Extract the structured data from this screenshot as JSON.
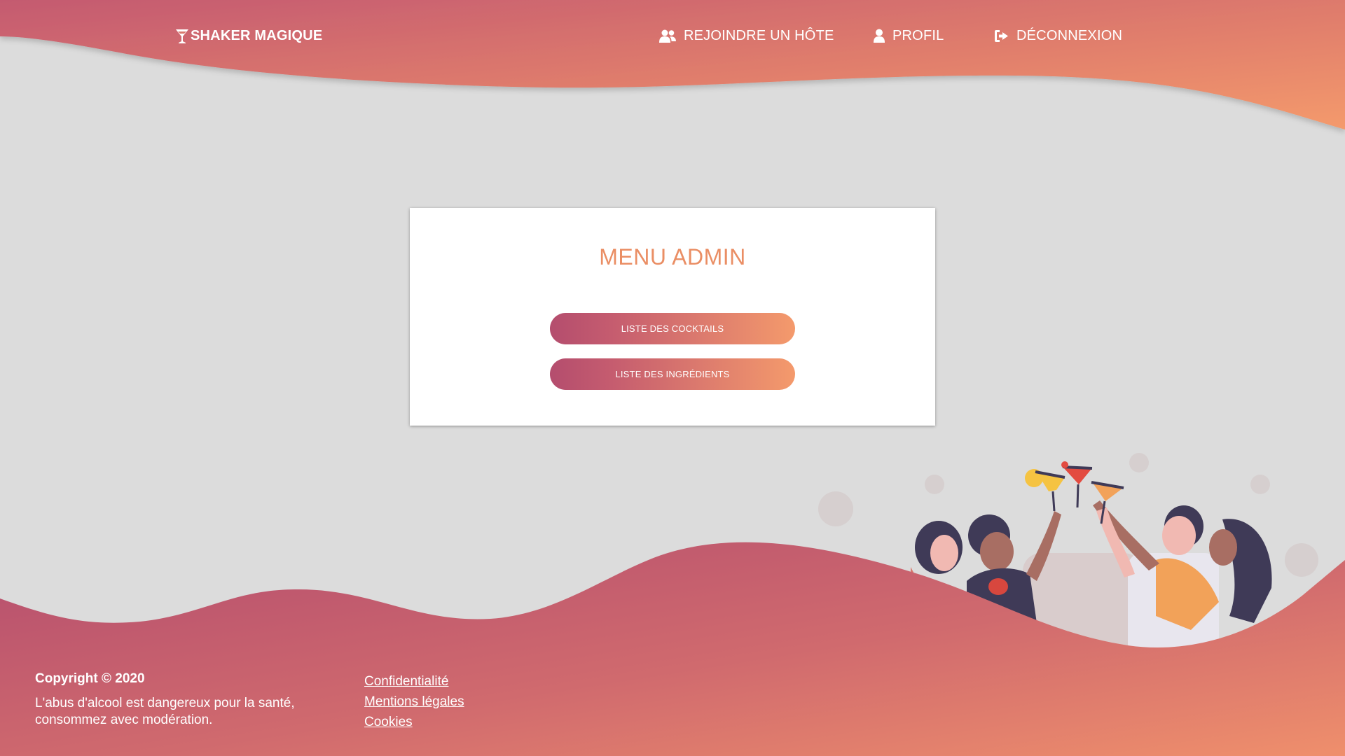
{
  "nav": {
    "brand": "SHAKER MAGIQUE",
    "join_host": "REJOINDRE UN HÔTE",
    "profile": "PROFIL",
    "logout": "DÉCONNEXION"
  },
  "card": {
    "title": "MENU ADMIN",
    "buttons": [
      "LISTE DES COCKTAILS",
      "LISTE DES INGRÉDIENTS"
    ]
  },
  "footer": {
    "copyright": "Copyright © 2020",
    "warning": "L'abus d'alcool est dangereux pour la santé, consommez avec modération.",
    "links": [
      "Confidentialité",
      "Mentions légales",
      "Cookies"
    ]
  },
  "colors": {
    "gradient_start": "#b44d6e",
    "gradient_end": "#f49a6c",
    "title_color": "#ea8e64",
    "background": "#dcdcdc"
  },
  "icons": {
    "brand": "cocktail-glass-icon",
    "join_host": "users-icon",
    "profile": "user-icon",
    "logout": "sign-out-icon"
  }
}
